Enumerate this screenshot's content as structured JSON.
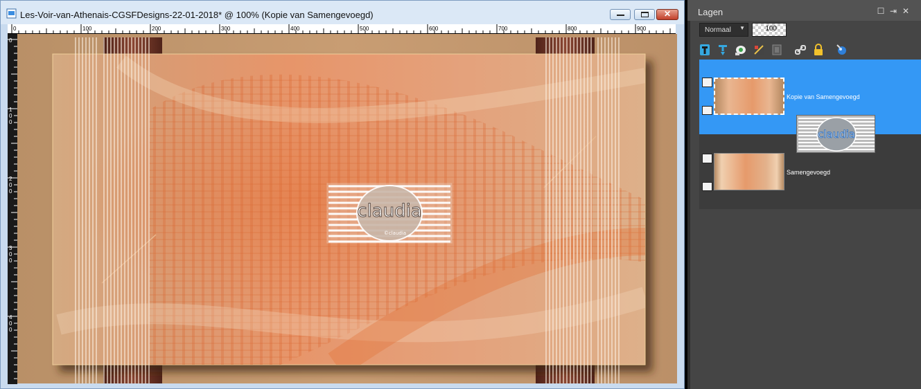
{
  "window": {
    "title": "Les-Voir-van-Athenais-CGSFDesigns-22-01-2018* @ 100% (Kopie van Samengevoegd)",
    "close_symbol": "✕",
    "icons": [
      "document-icon",
      "minimize-icon",
      "maximize-icon",
      "close-icon"
    ]
  },
  "ruler": {
    "h_labels": [
      "0",
      "100",
      "200",
      "300",
      "400",
      "500",
      "600",
      "700",
      "800",
      "900"
    ],
    "v_labels": [
      "0",
      "100",
      "200",
      "300",
      "400"
    ]
  },
  "watermark": {
    "text": "claudia",
    "subtext": "©claudia"
  },
  "palette": {
    "title": "Lagen",
    "blend_mode": "Normaal",
    "opacity": "100",
    "header_buttons": [
      "restore-icon",
      "pin-icon",
      "close-icon"
    ],
    "tools": [
      "new-raster-layer-icon",
      "new-vector-layer-icon",
      "mask-icon",
      "adjustment-layer-icon",
      "layer-properties-icon",
      "link-icon",
      "lock-icon",
      "delete-icon"
    ],
    "layers": [
      {
        "name": "Kopie van Samengevoegd",
        "selected": true
      },
      {
        "name": "Samengevoegd",
        "selected": false
      }
    ]
  },
  "colors": {
    "selection": "#3498f5",
    "canvas_base": "#bb8f65",
    "peach": "#e59a6e",
    "orange": "#e36f35"
  }
}
